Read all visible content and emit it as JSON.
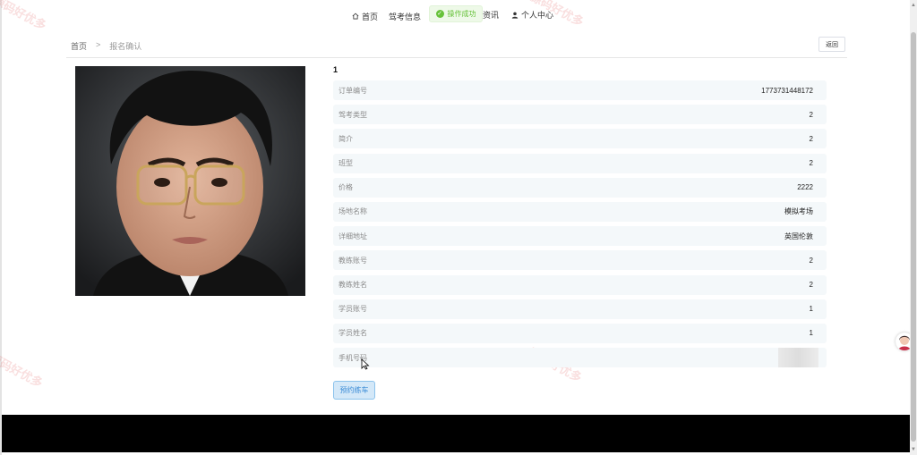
{
  "nav": {
    "home": "首页",
    "exam_info": "驾考信息",
    "news": "资讯",
    "user_center": "个人中心"
  },
  "toast": {
    "message": "操作成功"
  },
  "breadcrumb": {
    "home": "首页",
    "separator": ">",
    "current": "报名确认"
  },
  "back_button": "返回",
  "detail": {
    "title": "1",
    "rows": [
      {
        "label": "订单编号",
        "value": "1773731448172"
      },
      {
        "label": "驾考类型",
        "value": "2"
      },
      {
        "label": "简介",
        "value": "2"
      },
      {
        "label": "班型",
        "value": "2"
      },
      {
        "label": "价格",
        "value": "2222"
      },
      {
        "label": "场地名称",
        "value": "模拟考场"
      },
      {
        "label": "详细地址",
        "value": "英国伦敦"
      },
      {
        "label": "教练账号",
        "value": "2"
      },
      {
        "label": "教练姓名",
        "value": "2"
      },
      {
        "label": "学员账号",
        "value": "1"
      },
      {
        "label": "学员姓名",
        "value": "1"
      },
      {
        "label": "手机号码",
        "value": ""
      }
    ]
  },
  "book_button": "预约练车",
  "watermark": "源码好优多",
  "icons": {
    "home": "home-icon",
    "user": "user-icon",
    "success": "check-circle-icon"
  },
  "colors": {
    "toast_text": "#67c23a",
    "book_button_bg": "#d4e8f8",
    "footer": "#000000"
  }
}
